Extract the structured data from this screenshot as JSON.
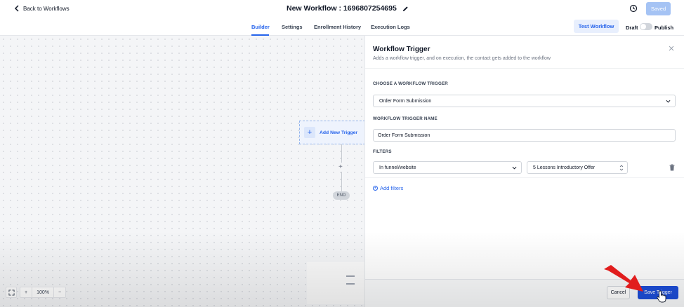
{
  "header": {
    "back_label": "Back to Workflows",
    "title": "New Workflow : 1696807254695",
    "saved_label": "Saved"
  },
  "tabs": {
    "items": [
      "Builder",
      "Settings",
      "Enrollment History",
      "Execution Logs"
    ],
    "active": "Builder",
    "test_label": "Test Workflow",
    "draft_label": "Draft",
    "publish_label": "Publish",
    "published": false
  },
  "canvas": {
    "add_trigger_label": "Add New Trigger",
    "end_label": "END",
    "zoom_level": "100%"
  },
  "panel": {
    "title": "Workflow Trigger",
    "subtitle": "Adds a workflow trigger, and on execution, the contact gets added to the workflow",
    "choose_label": "CHOOSE A WORKFLOW TRIGGER",
    "choose_value": "Order Form Submission",
    "name_label": "WORKFLOW TRIGGER NAME",
    "name_value": "Order Form Submission",
    "filters_label": "FILTERS",
    "filter_field": "In funnel/website",
    "filter_value": "5 Lessons Introductory Offer",
    "add_filters_label": "Add filters",
    "cancel_label": "Cancel",
    "save_label": "Save Trigger"
  },
  "colors": {
    "accent": "#2563eb",
    "save_button": "#1d4ed8",
    "saved_button": "#a5c3f4",
    "annotation_arrow": "#e11d1d"
  }
}
